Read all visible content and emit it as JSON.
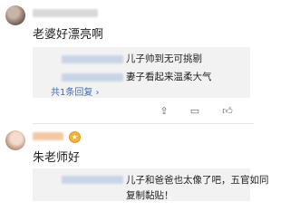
{
  "comment1": {
    "text": "老婆好漂亮啊",
    "replies": [
      {
        "text": "儿子帅到无可挑剔"
      },
      {
        "text": "妻子看起来温柔大气"
      }
    ],
    "reply_count": "共1条回复 ›"
  },
  "comment2": {
    "text": "朱老师好",
    "replies": [
      {
        "text": "儿子和爸爸也太像了吧，五官如同复制黏贴！"
      }
    ]
  },
  "icons": [
    "share-icon",
    "reply-icon",
    "like-icon"
  ]
}
